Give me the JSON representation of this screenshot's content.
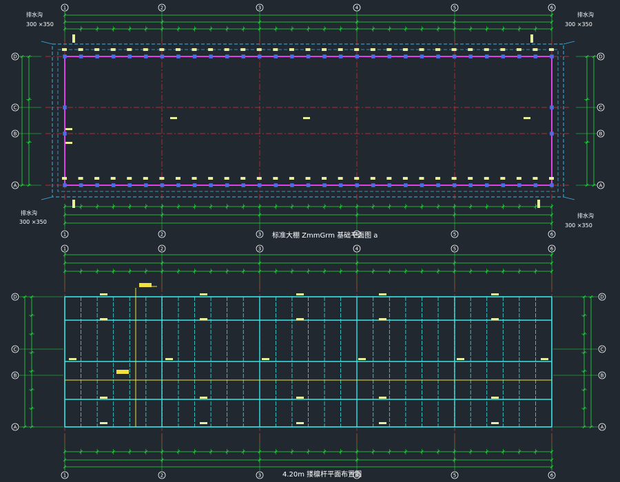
{
  "axes_x": [
    "1",
    "2",
    "3",
    "4",
    "5",
    "6"
  ],
  "axes_y": [
    "D",
    "C",
    "B",
    "A"
  ],
  "colors": {
    "background": "#212830",
    "dimension": "#22e43c",
    "grid_axis": "#e0302c",
    "foundation_beam": "#e040e8",
    "drain_line": "#3fb5e8",
    "roof_grid": "#38e6e6",
    "ridge": "#f0e040",
    "column": "#4a6de8"
  },
  "top_plan": {
    "title": "标准大棚 ZmmGrm 基础平面图 a",
    "drain_labels": [
      {
        "text": "排水沟",
        "size": "300 ×350",
        "corner": "top-left"
      },
      {
        "text": "排水沟",
        "size": "300 ×350",
        "corner": "top-right"
      },
      {
        "text": "排水沟",
        "size": "300 ×350",
        "corner": "bottom-left"
      },
      {
        "text": "排水沟",
        "size": "300 ×350",
        "corner": "bottom-right"
      }
    ]
  },
  "bottom_plan": {
    "title": "4.20m 搂檩杆平面布置图"
  }
}
